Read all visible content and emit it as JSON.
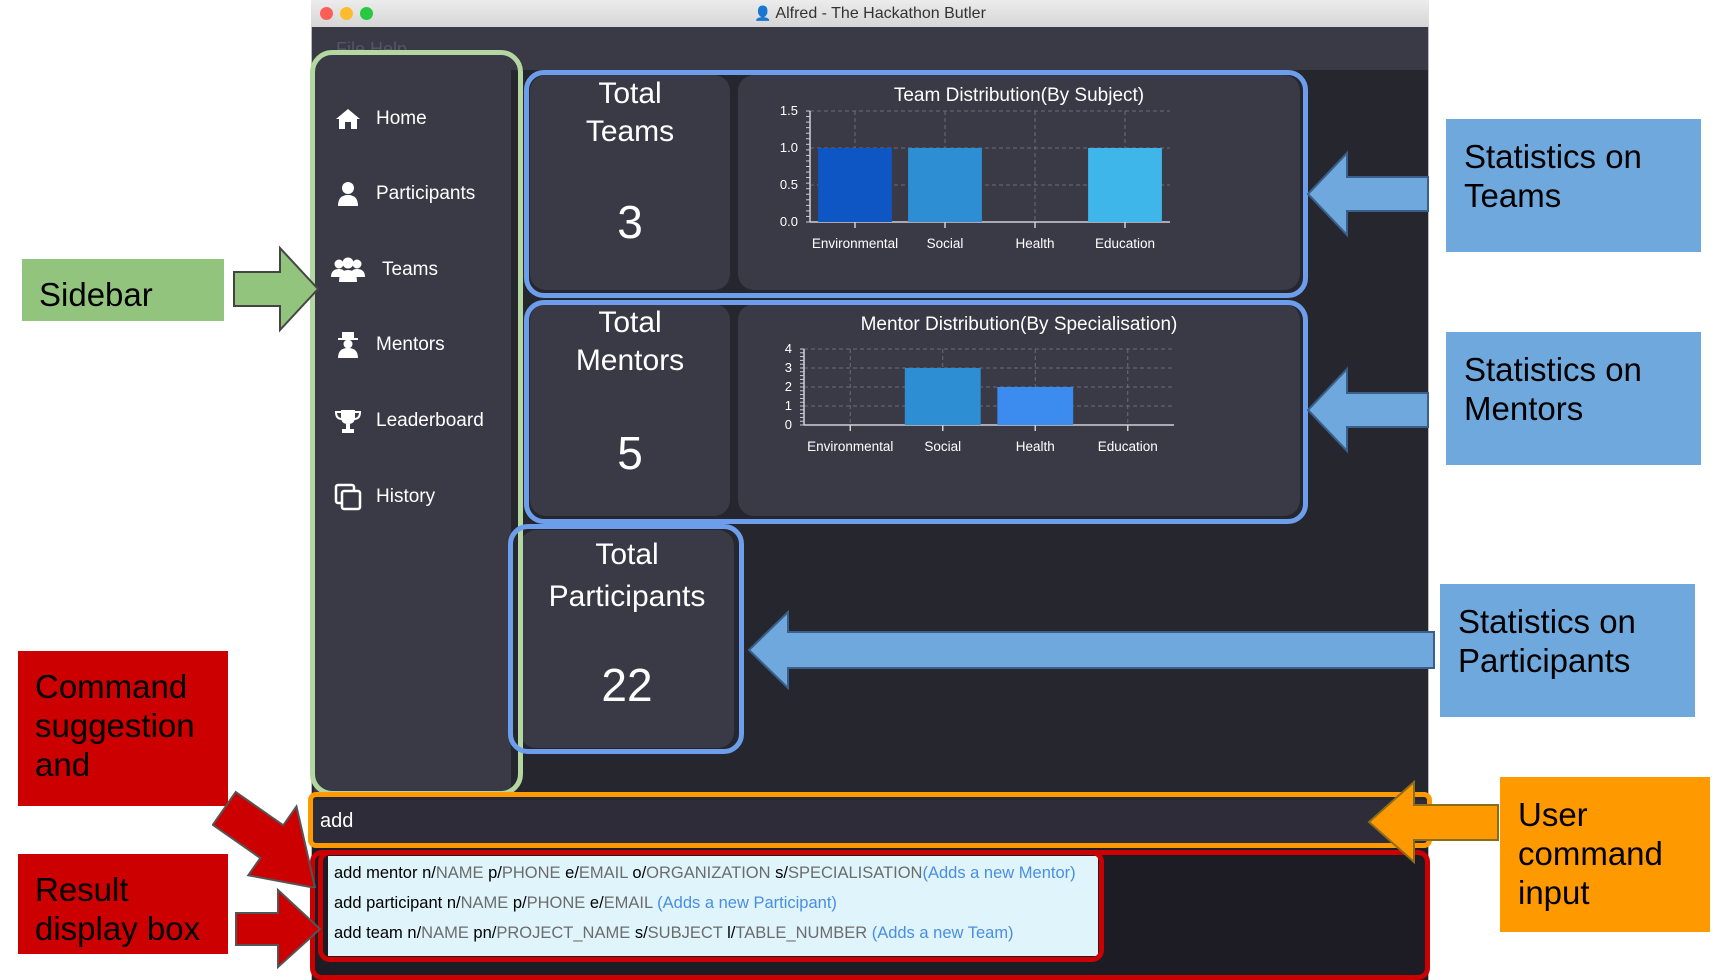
{
  "window": {
    "title": "Alfred - The Hackathon Butler",
    "menu_text": "File   Help"
  },
  "sidebar": {
    "items": [
      {
        "label": "Home",
        "icon": "home-icon"
      },
      {
        "label": "Participants",
        "icon": "person-icon"
      },
      {
        "label": "Teams",
        "icon": "group-icon"
      },
      {
        "label": "Mentors",
        "icon": "mentor-icon"
      },
      {
        "label": "Leaderboard",
        "icon": "trophy-icon"
      },
      {
        "label": "History",
        "icon": "history-icon"
      }
    ]
  },
  "stats": {
    "teams": {
      "label_line1": "Total",
      "label_line2": "Teams",
      "value": "3"
    },
    "mentors": {
      "label_line1": "Total",
      "label_line2": "Mentors",
      "value": "5"
    },
    "participants": {
      "label_line1": "Total",
      "label_line2": "Participants",
      "value": "22"
    }
  },
  "chart_data": [
    {
      "type": "bar",
      "title": "Team Distribution(By Subject)",
      "categories": [
        "Environmental",
        "Social",
        "Health",
        "Education"
      ],
      "values": [
        1,
        1,
        0,
        1
      ],
      "ylim": [
        0,
        1.5
      ],
      "yticks": [
        "0.0",
        "0.5",
        "1.0",
        "1.5"
      ],
      "grid": true
    },
    {
      "type": "bar",
      "title": "Mentor Distribution(By Specialisation)",
      "categories": [
        "Environmental",
        "Social",
        "Health",
        "Education"
      ],
      "values": [
        0,
        3,
        2,
        0
      ],
      "ylim": [
        0,
        4
      ],
      "yticks": [
        "0",
        "1",
        "2",
        "3",
        "4"
      ],
      "grid": true
    }
  ],
  "command": {
    "input_value": "add"
  },
  "suggestions": [
    {
      "cmd": "add mentor ",
      "parts": [
        [
          "n/",
          "NAME"
        ],
        [
          "p/",
          "PHONE"
        ],
        [
          "e/",
          "EMAIL"
        ],
        [
          "o/",
          "ORGANIZATION"
        ],
        [
          "s/",
          "SPECIALISATION"
        ]
      ],
      "desc": "(Adds a new Mentor)"
    },
    {
      "cmd": "add participant ",
      "parts": [
        [
          "n/",
          "NAME"
        ],
        [
          "p/",
          "PHONE"
        ],
        [
          "e/",
          "EMAIL"
        ]
      ],
      "desc": " (Adds a new Participant)"
    },
    {
      "cmd": "add team ",
      "parts": [
        [
          "n/",
          "NAME"
        ],
        [
          "pn/",
          "PROJECT_NAME"
        ],
        [
          "s/",
          "SUBJECT"
        ],
        [
          "l/",
          "TABLE_NUMBER"
        ]
      ],
      "desc": " (Adds a new Team)"
    }
  ],
  "annotations": {
    "sidebar": "Sidebar",
    "teams": "Statistics on Teams",
    "mentors": "Statistics on Mentors",
    "participants": "Statistics on Participants",
    "suggestion": "Command suggestion and",
    "result": "Result display box",
    "input": "User command input"
  },
  "colors": {
    "green": "#93c47d",
    "blue": "#6fa8dc",
    "red": "#cc0000",
    "orange": "#ff9900",
    "bar_dark": "#0d56c4",
    "bar_mid": "#2e8ed4",
    "bar_light": "#3fb6ea"
  }
}
